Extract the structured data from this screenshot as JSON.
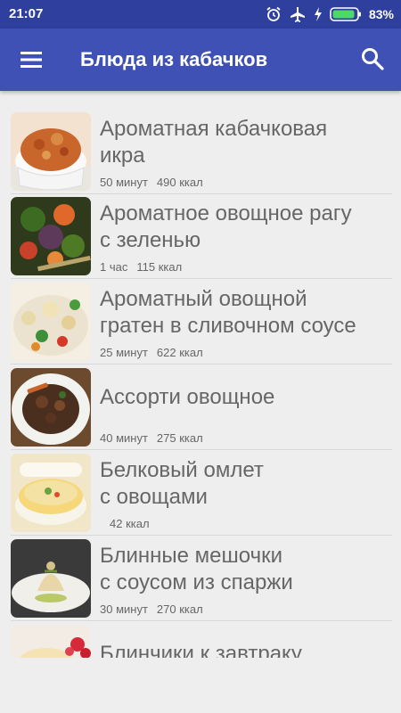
{
  "status": {
    "time": "21:07",
    "battery": "83%"
  },
  "appbar": {
    "title": "Блюда из кабачков"
  },
  "recipes": [
    {
      "name1": "Ароматная кабачковая",
      "name2": "икра",
      "time": "50 минут",
      "kcal": "490 ккал"
    },
    {
      "name1": "Ароматное овощное рагу",
      "name2": "с зеленью",
      "time": "1 час",
      "kcal": "115 ккал"
    },
    {
      "name1": "Ароматный овощной",
      "name2": "гратен в сливочном соусе",
      "time": "25 минут",
      "kcal": "622 ккал"
    },
    {
      "name1": "Ассорти овощное",
      "name2": "",
      "time": "40 минут",
      "kcal": "275 ккал"
    },
    {
      "name1": "Белковый омлет",
      "name2": "с овощами",
      "time": "",
      "kcal": "42 ккал"
    },
    {
      "name1": "Блинные мешочки",
      "name2": "с соусом из спаржи",
      "time": "30 минут",
      "kcal": "270 ккал"
    },
    {
      "name1": "Блинчики к завтраку",
      "name2": "",
      "time": "",
      "kcal": ""
    }
  ]
}
